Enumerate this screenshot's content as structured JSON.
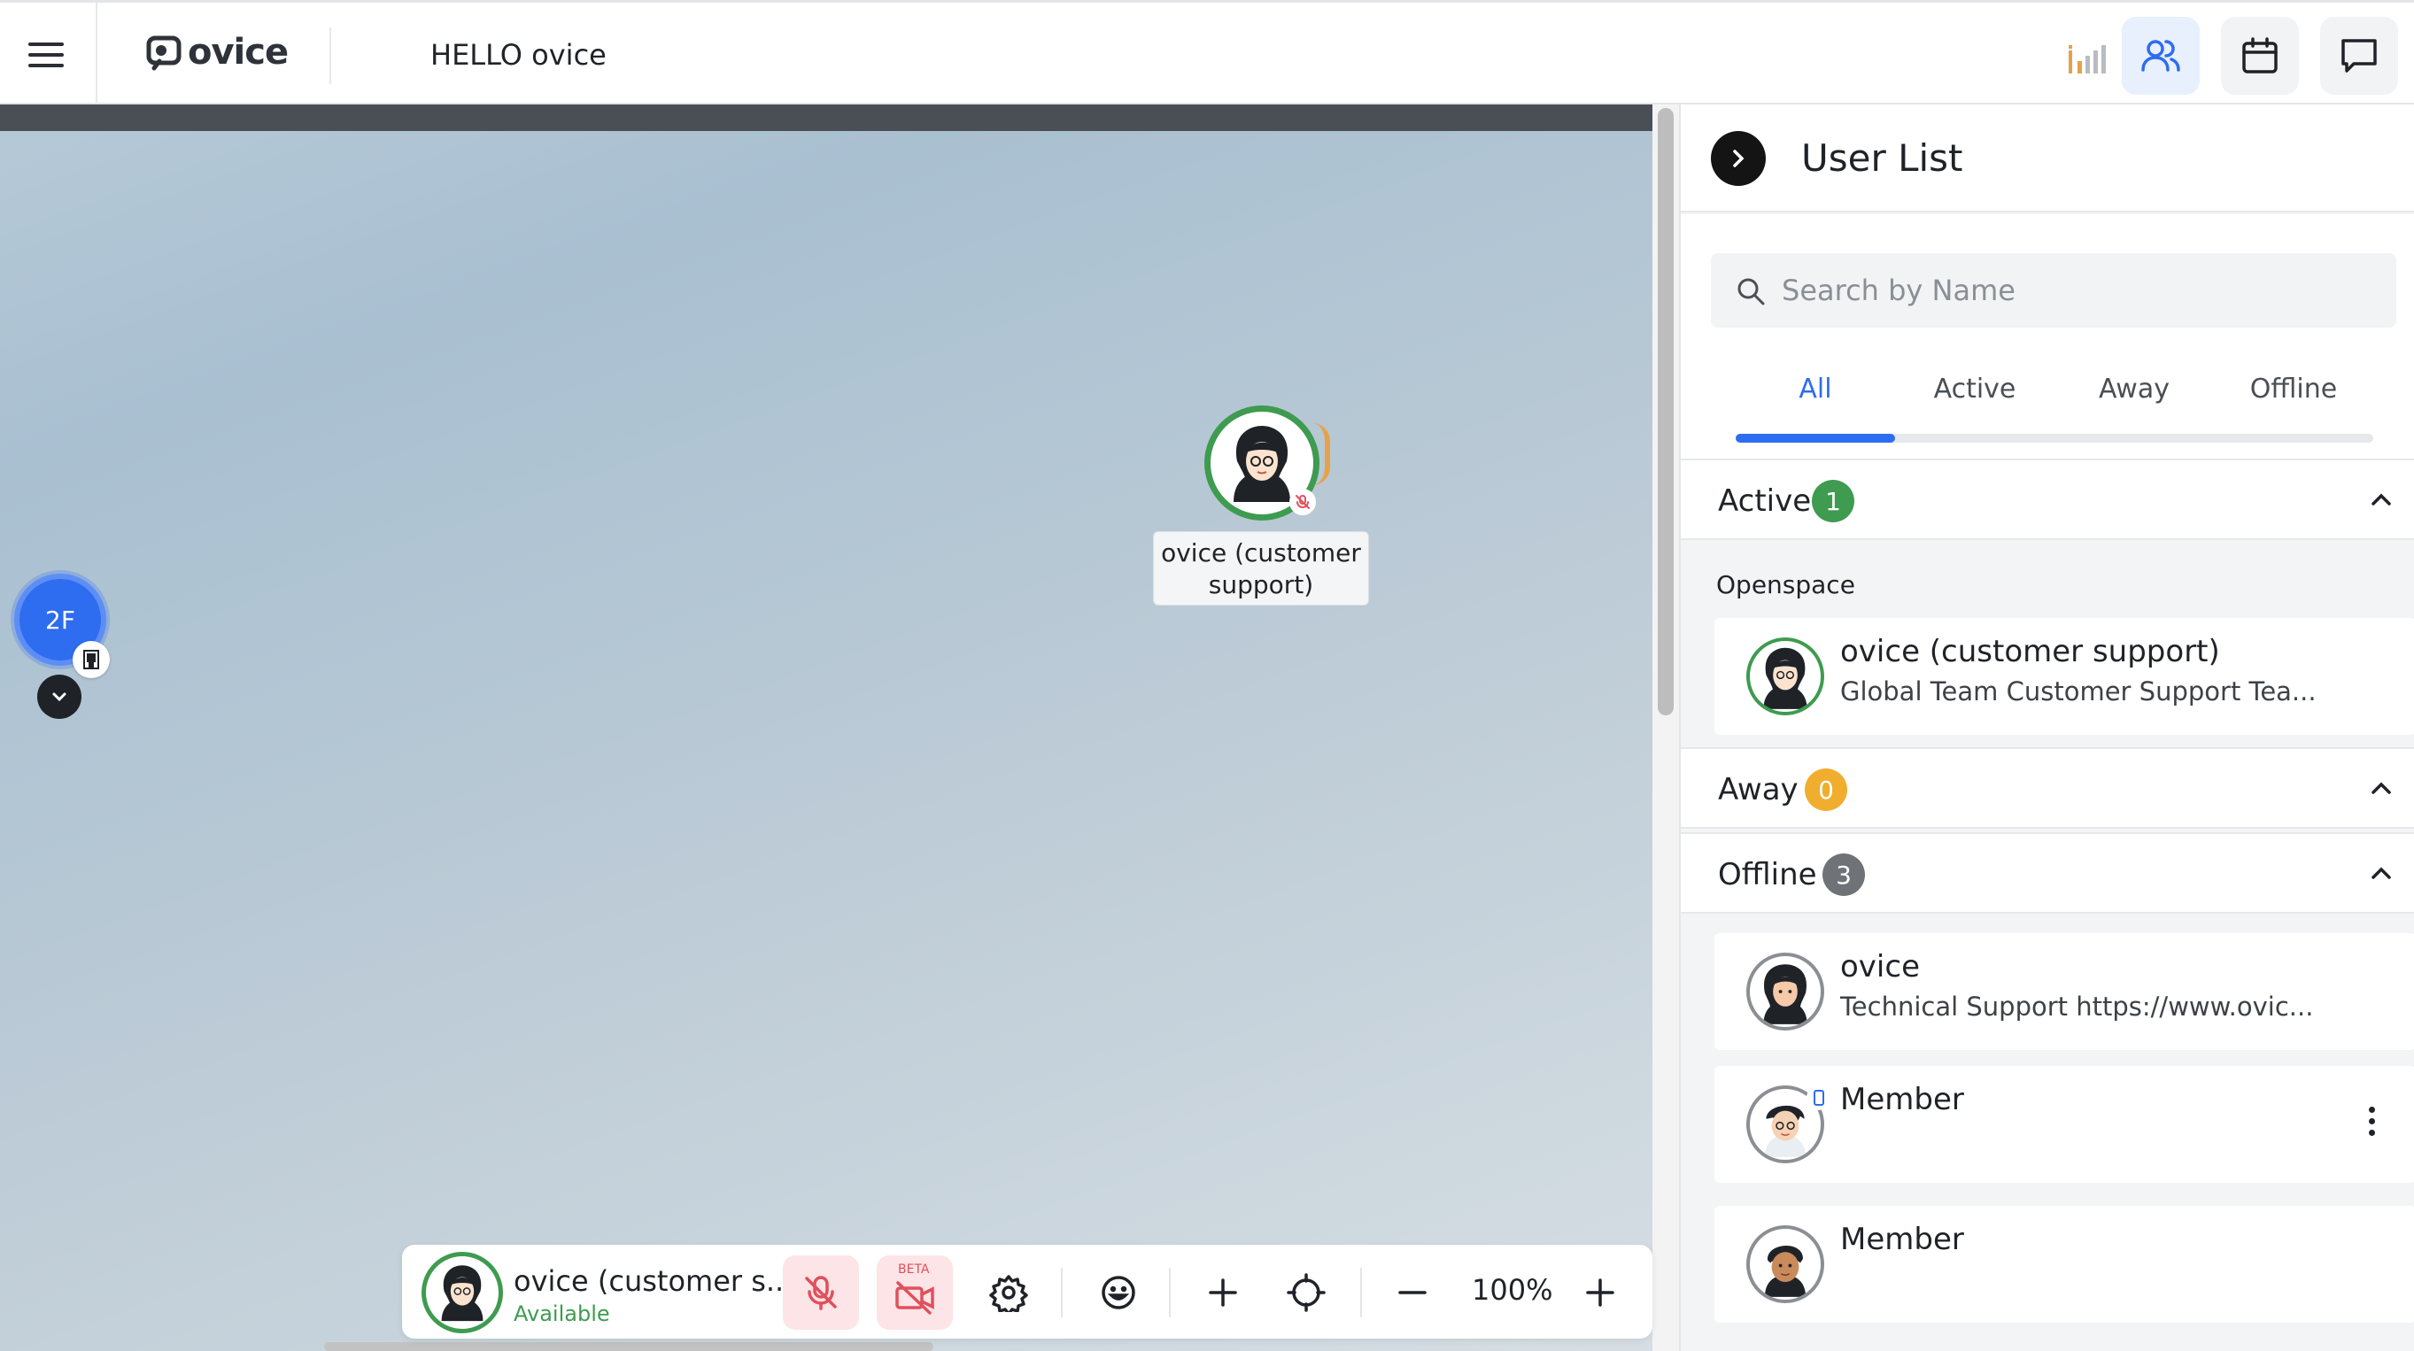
{
  "header": {
    "logo_text": "ovice",
    "space_title": "HELLO ovice",
    "icons": {
      "menu": "hamburger-icon",
      "signal": "signal-strength-icon",
      "users": "users-icon",
      "calendar": "calendar-icon",
      "chat": "chat-icon"
    },
    "accent_color": "#2e6cf0"
  },
  "map": {
    "floor_label": "2F",
    "user_label": "ovice (customer support)",
    "user_ring_color": "#3e9b4f"
  },
  "toolbar": {
    "user_name": "ovice (customer s..",
    "user_status": "Available",
    "beta_label": "BETA",
    "zoom_level": "100%",
    "icons": [
      "mic-off-icon",
      "camera-off-icon",
      "settings-icon",
      "emoji-icon",
      "plus-icon",
      "locate-icon",
      "zoom-out-icon",
      "zoom-in-icon"
    ]
  },
  "panel": {
    "title": "User List",
    "search_placeholder": "Search by Name",
    "tabs": [
      "All",
      "Active",
      "Away",
      "Offline"
    ],
    "active_tab": "All",
    "sections": {
      "active": {
        "title": "Active",
        "count": "1",
        "badge_color": "#3e9b4f"
      },
      "away": {
        "title": "Away",
        "count": "0",
        "badge_color": "#f0ad2e"
      },
      "offline": {
        "title": "Offline",
        "count": "3",
        "badge_color": "#6f7378"
      }
    },
    "active_group_label": "Openspace",
    "active_users": [
      {
        "name": "ovice (customer support)",
        "subtitle": "Global Team Customer Support Tea..."
      }
    ],
    "offline_users": [
      {
        "name": "ovice",
        "subtitle": "Technical Support https://www.ovic..."
      },
      {
        "name": "Member",
        "subtitle": ""
      },
      {
        "name": "Member",
        "subtitle": ""
      }
    ]
  }
}
